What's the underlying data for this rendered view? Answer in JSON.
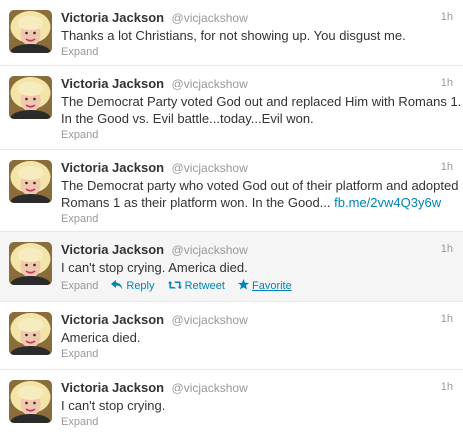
{
  "tweets": [
    {
      "fullname": "Victoria Jackson",
      "username": "@vicjackshow",
      "time": "1h",
      "lines": [
        "Thanks a lot Christians, for not showing up. You disgust me."
      ],
      "expand": "Expand"
    },
    {
      "fullname": "Victoria Jackson",
      "username": "@vicjackshow",
      "time": "1h",
      "lines": [
        "The Democrat Party voted God out and replaced Him with Romans 1.",
        "In the Good vs. Evil battle...today...Evil won."
      ],
      "expand": "Expand"
    },
    {
      "fullname": "Victoria Jackson",
      "username": "@vicjackshow",
      "time": "1h",
      "lines": [
        "The Democrat party who voted God out of their platform and adopted",
        "Romans 1 as their platform won. In the Good..."
      ],
      "link": "fb.me/2vw4Q3y6w",
      "expand": "Expand"
    },
    {
      "fullname": "Victoria Jackson",
      "username": "@vicjackshow",
      "time": "1h",
      "lines": [
        "I can't stop crying. America died."
      ],
      "expand": "Expand",
      "reply": "Reply",
      "retweet": "Retweet",
      "favorite": "Favorite"
    },
    {
      "fullname": "Victoria Jackson",
      "username": "@vicjackshow",
      "time": "1h",
      "lines": [
        "America died."
      ],
      "expand": "Expand"
    },
    {
      "fullname": "Victoria Jackson",
      "username": "@vicjackshow",
      "time": "1h",
      "lines": [
        "I can't stop crying."
      ],
      "expand": "Expand"
    }
  ],
  "colors": {
    "link": "#0084b4",
    "meta": "#999999",
    "text": "#333333",
    "hover_bg": "#f5f5f5"
  },
  "icons": {
    "avatar": "profile-photo",
    "reply": "reply-arrow-icon",
    "retweet": "retweet-icon",
    "favorite": "star-icon"
  }
}
